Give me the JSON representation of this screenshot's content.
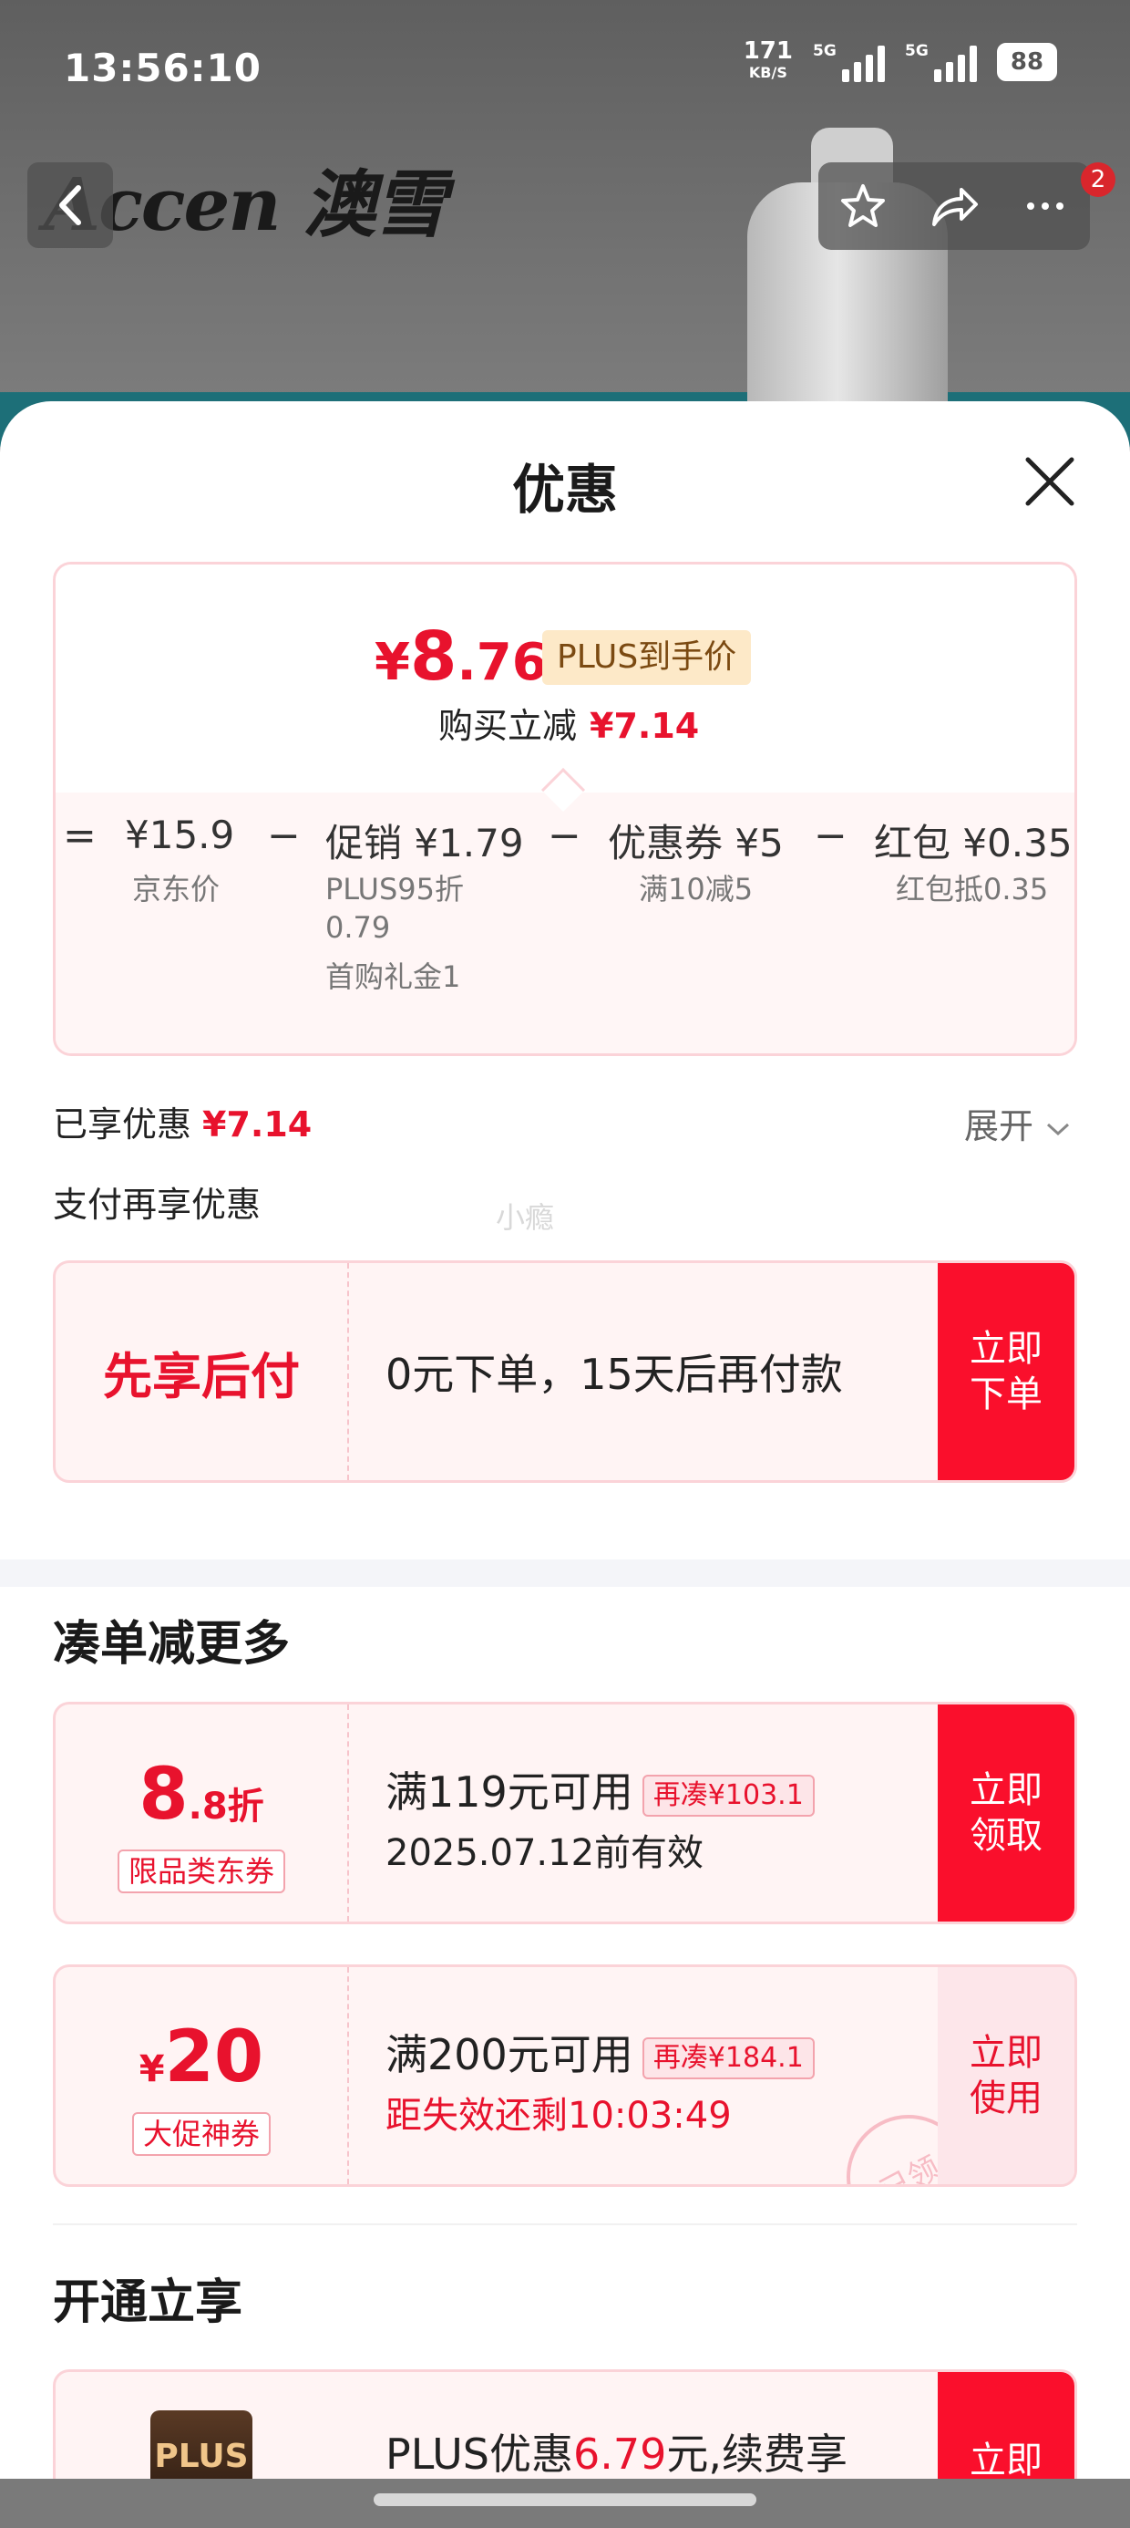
{
  "status_bar": {
    "time": "13:56:10",
    "speed_value": "171",
    "speed_unit": "KB/S",
    "signal_1_tag": "5G",
    "signal_2_tag": "5G",
    "battery": "88"
  },
  "background": {
    "brand": "Accen 澳雪",
    "nav_badge_count": "2",
    "icons": [
      "back-arrow-icon",
      "star-icon",
      "share-icon",
      "more-icon"
    ]
  },
  "sheet": {
    "title": "优惠",
    "close_icon": "close-icon",
    "price_card": {
      "price_symbol": "¥",
      "price_int": "8",
      "price_dec": ".76",
      "plus_label": "PLUS到手价",
      "reduce_label": "购买立减",
      "reduce_value": "¥7.14",
      "breakdown": {
        "eq": "=",
        "op1": "−",
        "op2": "−",
        "op3": "−",
        "jd_price": "¥15.9",
        "jd_price_label": "京东价",
        "promo": "促销 ¥1.79",
        "promo_sub1": "PLUS95折",
        "promo_sub2": "0.79",
        "promo_sub3": "首购礼金1",
        "coupon": "优惠券 ¥5",
        "coupon_sub": "满10减5",
        "redpacket": "红包 ¥0.35",
        "redpacket_sub": "红包抵0.35"
      }
    },
    "applied_label": "已享优惠",
    "applied_value": "¥7.14",
    "expand_label": "展开",
    "pay_more_label": "支付再享优惠",
    "watermark": "小瘾",
    "bnpl": {
      "title": "先享后付",
      "text": "0元下单，15天后再付款",
      "button_line1": "立即",
      "button_line2": "下单"
    },
    "bundle_title": "凑单减更多",
    "coupons": [
      {
        "amount_big": "8",
        "amount_small": ".8折",
        "tag": "限品类东券",
        "main": "满119元可用",
        "topup": "再凑¥103.1",
        "sub": "2025.07.12前有效",
        "button_line1": "立即",
        "button_line2": "领取"
      },
      {
        "amount_small_prefix": "¥",
        "amount_big": "20",
        "tag": "大促神券",
        "main": "满200元可用",
        "topup": "再凑¥184.1",
        "sub": "距失效还剩10:03:49",
        "button_line1": "立即",
        "button_line2": "使用",
        "stamp": "已领"
      }
    ],
    "plus_section_title": "开通立享",
    "plus_card": {
      "logo": "PLUS",
      "text_prefix": "PLUS优惠",
      "text_amount": "6.79",
      "text_suffix": "元,续费享",
      "button_line1": "立即"
    }
  }
}
